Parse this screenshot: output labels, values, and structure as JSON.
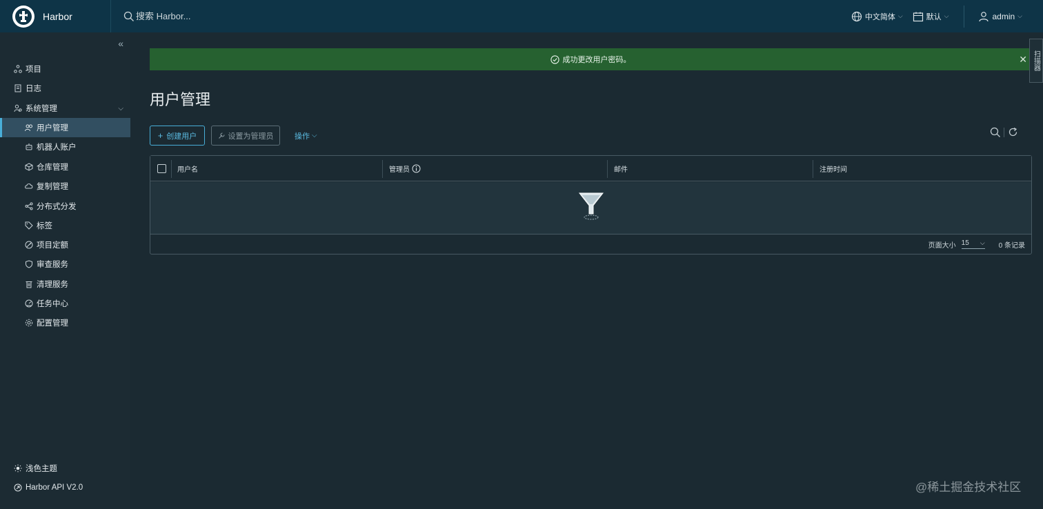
{
  "header": {
    "brand": "Harbor",
    "search_placeholder": "搜索 Harbor...",
    "language": "中文简体",
    "date_format": "默认",
    "user": "admin",
    "icons": [
      "harbor-logo-icon",
      "search-icon",
      "globe-icon",
      "calendar-icon",
      "user-icon"
    ]
  },
  "sidebar": {
    "items": [
      {
        "label": "项目",
        "icon": "projects-icon"
      },
      {
        "label": "日志",
        "icon": "logs-icon"
      },
      {
        "label": "系统管理",
        "icon": "admin-icon"
      },
      {
        "label": "用户管理",
        "icon": "users-icon",
        "active": true
      },
      {
        "label": "机器人账户",
        "icon": "robot-icon"
      },
      {
        "label": "仓库管理",
        "icon": "registry-icon"
      },
      {
        "label": "复制管理",
        "icon": "replication-icon"
      },
      {
        "label": "分布式分发",
        "icon": "distribution-icon"
      },
      {
        "label": "标签",
        "icon": "tag-icon"
      },
      {
        "label": "项目定额",
        "icon": "quota-icon"
      },
      {
        "label": "审查服务",
        "icon": "shield-icon"
      },
      {
        "label": "清理服务",
        "icon": "trash-icon"
      },
      {
        "label": "任务中心",
        "icon": "dashboard-icon"
      },
      {
        "label": "配置管理",
        "icon": "gear-icon"
      }
    ],
    "bottom": [
      {
        "label": "浅色主题",
        "icon": "sun-icon"
      },
      {
        "label": "Harbor API V2.0",
        "icon": "api-icon"
      }
    ]
  },
  "alert": {
    "message": "成功更改用户密码。"
  },
  "side_tab": "扫描器",
  "main": {
    "title": "用户管理",
    "create_user": "创建用户",
    "set_admin": "设置为管理员",
    "actions": "操作"
  },
  "table": {
    "columns": [
      "用户名",
      "管理员",
      "邮件",
      "注册时间"
    ],
    "rows": [],
    "footer": {
      "page_size_label": "页面大小",
      "page_size": "15",
      "record_count": "0 条记录"
    }
  },
  "watermark": "@稀土掘金技术社区",
  "colors": {
    "header_bg": "#0e3447",
    "sidebar_bg": "#1c2b33",
    "main_bg": "#1b2a32",
    "accent": "#49afd9",
    "success_bg": "#266130"
  }
}
